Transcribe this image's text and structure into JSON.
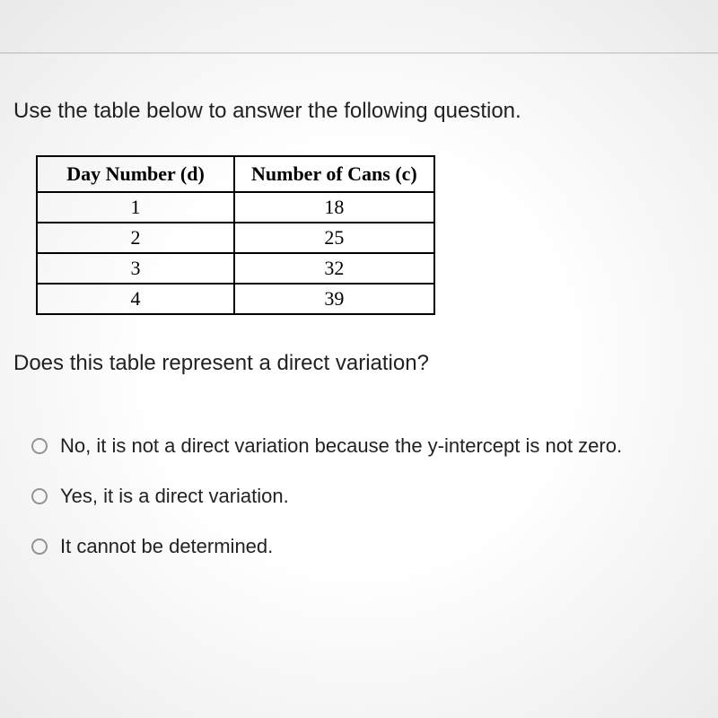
{
  "instruction": "Use the table below to answer the following question.",
  "table": {
    "headers": [
      "Day Number (d)",
      "Number of Cans (c)"
    ],
    "rows": [
      [
        "1",
        "18"
      ],
      [
        "2",
        "25"
      ],
      [
        "3",
        "32"
      ],
      [
        "4",
        "39"
      ]
    ]
  },
  "question": "Does this table represent a direct variation?",
  "options": [
    "No, it is not a direct variation because the y-intercept is not zero.",
    "Yes, it is a direct variation.",
    "It cannot be determined."
  ],
  "chart_data": {
    "type": "table",
    "title": "",
    "columns": [
      "Day Number (d)",
      "Number of Cans (c)"
    ],
    "data": [
      {
        "d": 1,
        "c": 18
      },
      {
        "d": 2,
        "c": 25
      },
      {
        "d": 3,
        "c": 32
      },
      {
        "d": 4,
        "c": 39
      }
    ]
  }
}
